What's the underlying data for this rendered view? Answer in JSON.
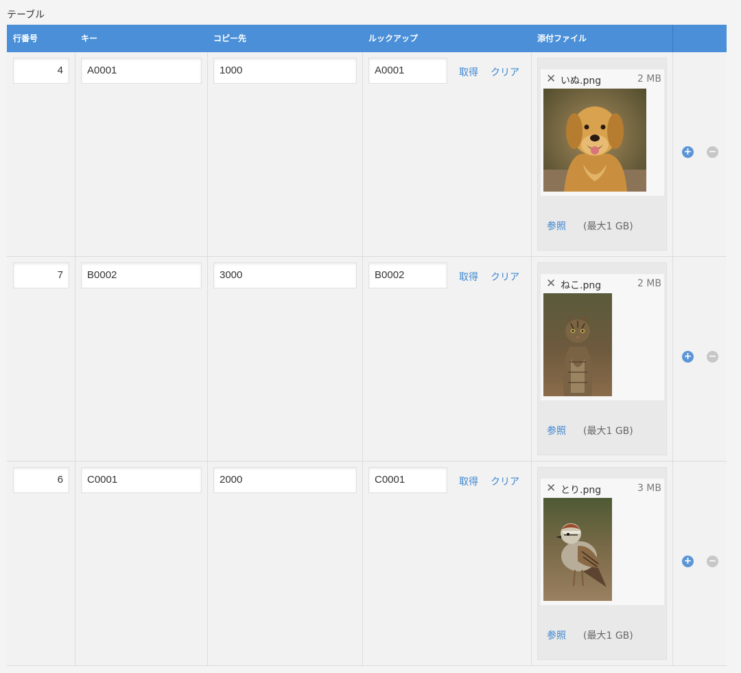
{
  "title": "テーブル",
  "columns": {
    "row_no": "行番号",
    "key": "キー",
    "copy_to": "コピー先",
    "lookup": "ルックアップ",
    "attachment": "添付ファイル"
  },
  "labels": {
    "fetch": "取得",
    "clear": "クリア",
    "browse": "参照",
    "max_size": "(最大1 GB)",
    "remove": "✕",
    "add_row": "+",
    "delete_row": "−"
  },
  "rows": [
    {
      "row_no": "4",
      "key": "A0001",
      "copy_to": "1000",
      "lookup": "A0001",
      "file": {
        "name": "いぬ.png",
        "size": "2 MB",
        "image": "golden-retriever-photo"
      }
    },
    {
      "row_no": "7",
      "key": "B0002",
      "copy_to": "3000",
      "lookup": "B0002",
      "file": {
        "name": "ねこ.png",
        "size": "2 MB",
        "image": "tabby-cat-photo"
      }
    },
    {
      "row_no": "6",
      "key": "C0001",
      "copy_to": "2000",
      "lookup": "C0001",
      "file": {
        "name": "とり.png",
        "size": "3 MB",
        "image": "sparrow-photo"
      }
    }
  ],
  "colors": {
    "header": "#4a8fd8",
    "link": "#3d86cf",
    "add_button": "#5b95d8",
    "delete_button": "#c7c7c7"
  }
}
